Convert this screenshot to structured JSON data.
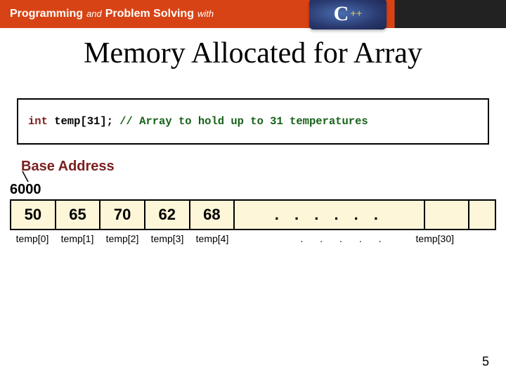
{
  "header": {
    "word1": "Programming",
    "word_and": "and",
    "word2": "Problem Solving",
    "word_with": "with",
    "badge_c": "C",
    "badge_pp": "++"
  },
  "title": "Memory Allocated for Array",
  "code": {
    "decl_prefix": "int",
    "decl_rest": " temp[31];",
    "comment": "// Array to hold up to 31 temperatures"
  },
  "base_address_label": "Base Address",
  "base_address_value": "6000",
  "cells": [
    "50",
    "65",
    "70",
    "62",
    "68"
  ],
  "cell_dots": ". . . . . .",
  "labels": [
    "temp[0]",
    "temp[1]",
    "temp[2]",
    "temp[3]",
    "temp[4]"
  ],
  "label_dots": ".  .  .  .  .",
  "label_last": "temp[30]",
  "page_number": "5",
  "chart_data": {
    "type": "table",
    "title": "Memory Allocated for Array",
    "description": "int temp[31] array contents at base address 6000",
    "base_address": 6000,
    "indices_shown": [
      0,
      1,
      2,
      3,
      4,
      30
    ],
    "values_shown": {
      "0": 50,
      "1": 65,
      "2": 70,
      "3": 62,
      "4": 68
    },
    "array_length": 31
  }
}
